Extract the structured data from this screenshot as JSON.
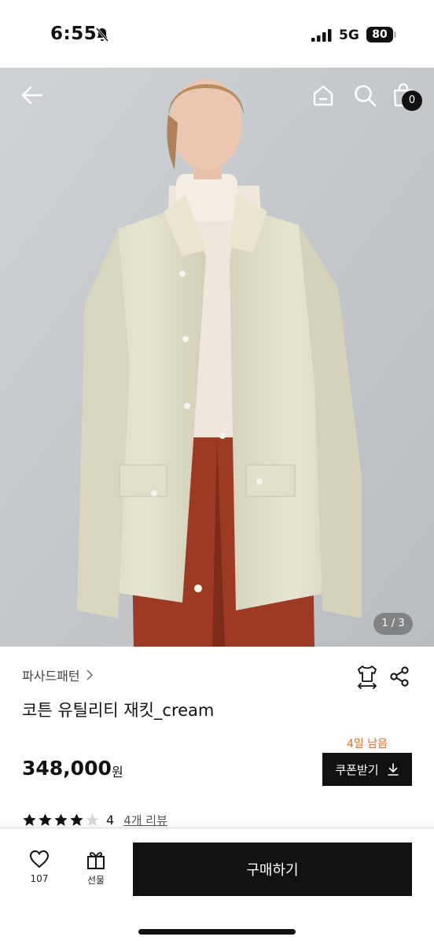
{
  "status_bar": {
    "time": "6:55",
    "network": "5G",
    "battery": "80"
  },
  "header": {
    "cart_count": "0"
  },
  "gallery": {
    "page_indicator": "1 / 3"
  },
  "product": {
    "brand": "파사드패턴",
    "title": "코튼 유틸리티 재킷_cream",
    "price": "348,000",
    "price_unit": "원",
    "coupon_days_left": "4일 남음",
    "coupon_button_label": "쿠폰받기",
    "rating": {
      "score": "4",
      "stars_filled": 4,
      "stars_total": 5
    },
    "review_link": "4개 리뷰"
  },
  "bottom_bar": {
    "like_count": "107",
    "gift_label": "선물",
    "buy_label": "구매하기"
  },
  "colors": {
    "accent_orange": "#e36b1e",
    "primary_black": "#111111"
  },
  "icons": [
    "arrow-left-icon",
    "home-icon",
    "search-icon",
    "shopping-bag-icon",
    "size-guide-icon",
    "share-icon",
    "chevron-right-icon",
    "download-icon",
    "star-icon",
    "heart-icon",
    "gift-icon",
    "bell-slash-icon",
    "signal-icon",
    "battery-icon"
  ]
}
